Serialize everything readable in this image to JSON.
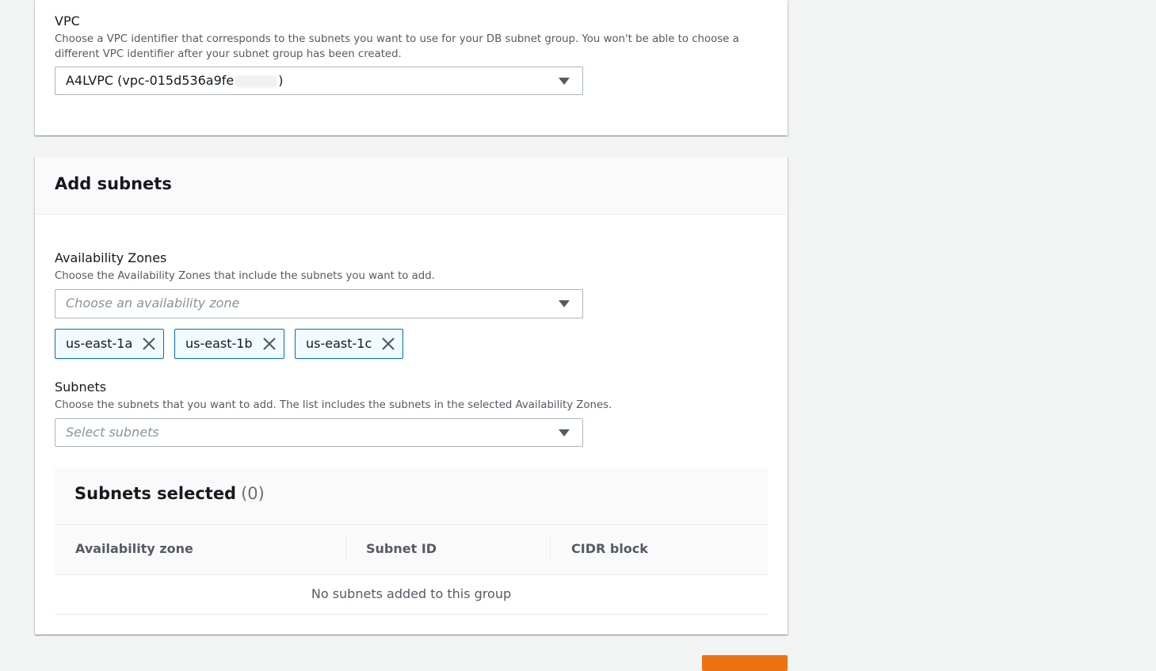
{
  "vpc": {
    "label": "VPC",
    "description": "Choose a VPC identifier that corresponds to the subnets you want to use for your DB subnet group. You won't be able to choose a different VPC identifier after your subnet group has been created.",
    "selected_prefix": "A4LVPC (vpc-015d536a9fe",
    "selected_suffix": ")"
  },
  "add_subnets": {
    "title": "Add subnets",
    "availability_zones": {
      "label": "Availability Zones",
      "description": "Choose the Availability Zones that include the subnets you want to add.",
      "placeholder": "Choose an availability zone",
      "tokens": [
        "us-east-1a",
        "us-east-1b",
        "us-east-1c"
      ]
    },
    "subnets": {
      "label": "Subnets",
      "description": "Choose the subnets that you want to add. The list includes the subnets in the selected Availability Zones.",
      "placeholder": "Select subnets"
    },
    "selected_table": {
      "title": "Subnets selected",
      "count": "(0)",
      "columns": [
        "Availability zone",
        "Subnet ID",
        "CIDR block"
      ],
      "empty_message": "No subnets added to this group"
    }
  },
  "icons": {
    "caret": "caret-down-icon",
    "remove": "close-icon"
  },
  "colors": {
    "token_border": "#0073bb",
    "token_bg": "#f1faff",
    "primary_button": "#ec7211"
  }
}
